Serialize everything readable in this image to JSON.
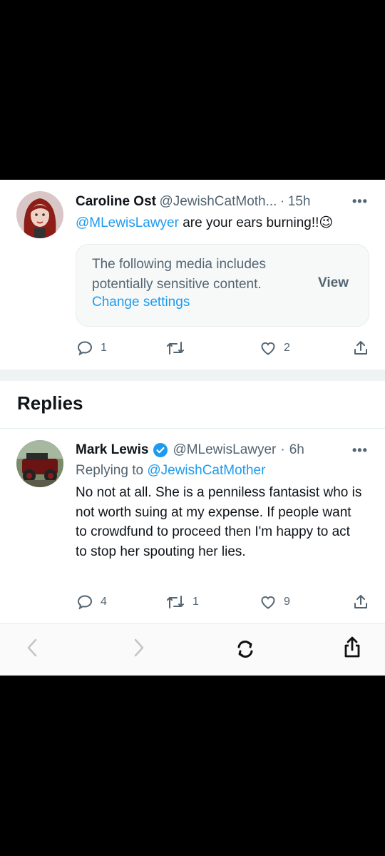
{
  "tweet": {
    "author_name": "Caroline Ost",
    "author_handle": "@JewishCatMoth...",
    "separator": "·",
    "time": "15h",
    "mention": "@MLewisLawyer",
    "text": "are your ears burning!!",
    "emoji": "😉",
    "media_warning": {
      "text": "The following media includes potentially sensitive content.",
      "view_label": "View",
      "change_label": "Change settings"
    },
    "actions": {
      "replies": "1",
      "retweets": "",
      "likes": "2"
    }
  },
  "replies_heading": "Replies",
  "reply": {
    "author_name": "Mark Lewis",
    "author_handle": "@MLewisLawyer",
    "separator": "·",
    "time": "6h",
    "replying_prefix": "Replying to",
    "replying_to": "@JewishCatMother",
    "text": "No not at all. She is a penniless fantasist who is not worth suing at my expense. If people want to crowdfund to proceed then I'm happy to act to stop her spouting her lies.",
    "actions": {
      "replies": "4",
      "retweets": "1",
      "likes": "9"
    }
  },
  "colors": {
    "accent": "#1d9bf0",
    "muted": "#536471",
    "text": "#0f1419",
    "verified": "#1d9bf0"
  },
  "icons": [
    "reply-icon",
    "retweet-icon",
    "like-icon",
    "share-icon",
    "more-icon",
    "verified-icon",
    "back-icon",
    "forward-icon",
    "reload-icon",
    "browser-share-icon"
  ]
}
